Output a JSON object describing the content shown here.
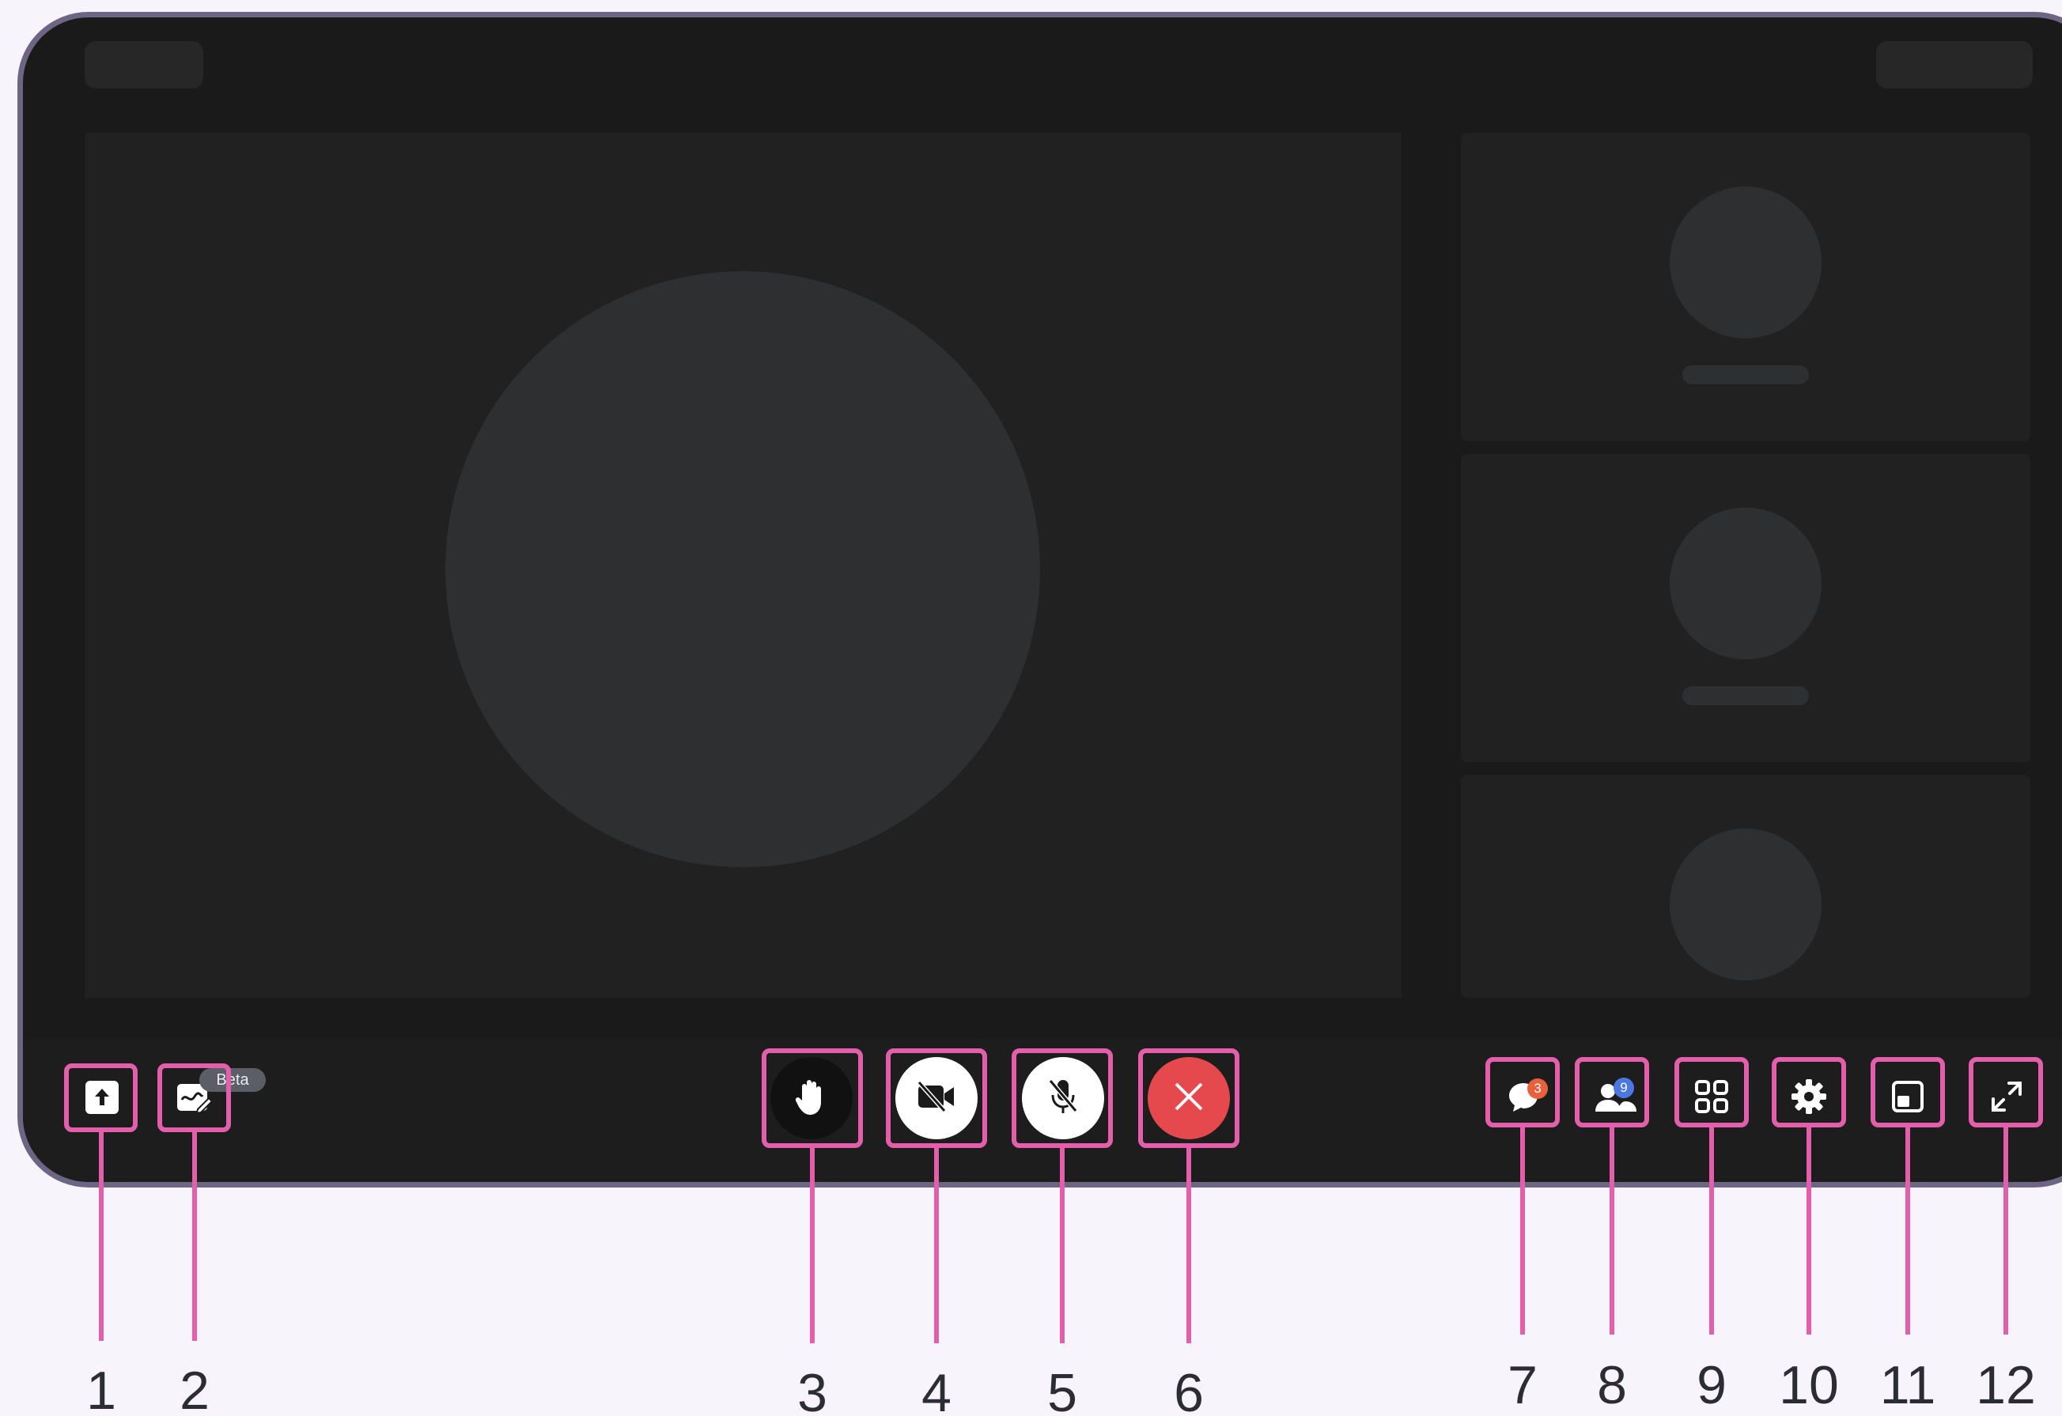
{
  "badges": {
    "whiteboard_beta": "Beta",
    "chat_unread": "3",
    "participants_count": "9"
  },
  "controls": [
    {
      "id": 1,
      "name": "share-screen",
      "icon": "upload-icon"
    },
    {
      "id": 2,
      "name": "whiteboard",
      "icon": "whiteboard-pen-icon"
    },
    {
      "id": 3,
      "name": "raise-hand",
      "icon": "hand-icon"
    },
    {
      "id": 4,
      "name": "camera-toggle",
      "icon": "video-off-icon"
    },
    {
      "id": 5,
      "name": "mic-toggle",
      "icon": "mic-off-icon"
    },
    {
      "id": 6,
      "name": "leave-call",
      "icon": "close-icon"
    },
    {
      "id": 7,
      "name": "chat",
      "icon": "chat-icon"
    },
    {
      "id": 8,
      "name": "participants",
      "icon": "people-icon"
    },
    {
      "id": 9,
      "name": "layout-grid",
      "icon": "grid-icon"
    },
    {
      "id": 10,
      "name": "settings",
      "icon": "gear-icon"
    },
    {
      "id": 11,
      "name": "picture-in-picture",
      "icon": "pip-icon"
    },
    {
      "id": 12,
      "name": "fullscreen",
      "icon": "expand-icon"
    }
  ],
  "callouts": [
    "1",
    "2",
    "3",
    "4",
    "5",
    "6",
    "7",
    "8",
    "9",
    "10",
    "11",
    "12"
  ],
  "colors": {
    "background": "#f7f5fb",
    "frame_border": "#6e6585",
    "screen": "#1a1a1a",
    "annotation": "#e35fac",
    "leave_red": "#e5484d",
    "chat_badge": "#e8603c",
    "participants_badge": "#4a78e0"
  }
}
